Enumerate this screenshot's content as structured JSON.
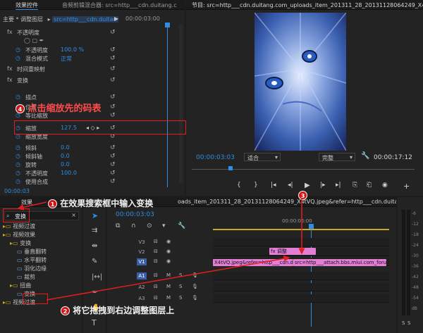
{
  "effect_controls": {
    "tab": "效果控件",
    "tab_audio": "音频剪辑混合器: src=http___cdn.duitang.c",
    "breadcrumb_master": "主要 * 调整图层",
    "breadcrumb_clip": "src=http___cdn.duitan",
    "timecode_top": "00:00:03:00",
    "rows": [
      {
        "label": "不透明度",
        "prefix": "fx"
      },
      {
        "label": "不透明度",
        "value": "100.0 %"
      },
      {
        "label": "混合模式",
        "value": "正常"
      },
      {
        "label": "时间重映射",
        "prefix": "fx"
      },
      {
        "label": "变换",
        "prefix": "fx"
      },
      {
        "label": "描点",
        "value": ""
      },
      {
        "label": "位置",
        "value": ""
      },
      {
        "label": "等比缩放",
        "value": ""
      },
      {
        "label": "缩放",
        "value": "127.5"
      },
      {
        "label": "缩放宽度",
        "value": ""
      },
      {
        "label": "倾斜",
        "value": "0.0"
      },
      {
        "label": "倾斜轴",
        "value": "0.0"
      },
      {
        "label": "旋转",
        "value": "0.0"
      },
      {
        "label": "不透明度",
        "value": "100.0"
      },
      {
        "label": "使用合成",
        "value": ""
      }
    ],
    "timecode_bottom": "00:00:03"
  },
  "program": {
    "title": "节目: src=http___cdn.duitang.com_uploads_item_201311_28_20131128064249_X4tVQ.jpeg&refer=h",
    "timecode": "00:00:03:03",
    "fit": "适合",
    "quality": "完整",
    "duration": "00:00:17:12"
  },
  "effects": {
    "tab": "效果",
    "search_value": "变换",
    "tree": [
      {
        "label": "视频过渡",
        "indent": 0
      },
      {
        "label": "视频效果",
        "indent": 0
      },
      {
        "label": "变换",
        "indent": 1
      },
      {
        "label": "垂直翻转",
        "indent": 2
      },
      {
        "label": "水平翻转",
        "indent": 2
      },
      {
        "label": "羽化边缘",
        "indent": 2
      },
      {
        "label": "裁剪",
        "indent": 2
      },
      {
        "label": "扭曲",
        "indent": 1
      },
      {
        "label": "变换",
        "indent": 2
      },
      {
        "label": "视频过渡",
        "indent": 0
      }
    ]
  },
  "timeline": {
    "tab": "oads_item_201311_28_20131128064249_X4tVQ.jpeg&refer=http___cdn.duitang",
    "timecode": "00:00:03:03",
    "ruler_time": "00:00:05:00",
    "tracks": [
      {
        "name": "V3"
      },
      {
        "name": "V2"
      },
      {
        "name": "V1"
      },
      {
        "name": "A1"
      },
      {
        "name": "A2"
      },
      {
        "name": "A3"
      }
    ],
    "clip_v2": "fx 调整",
    "clip_v1a": "X4tVQ.jpeg&refer=http___cdn.duitang",
    "clip_v1b": "src=http___attach.bbs.miui.com_forum_2019"
  },
  "annotations": {
    "a1": "在效果搜索框中输入变换",
    "a2": "将它拖拽到右边调整图层上",
    "a3": "",
    "a4": "点击缩放先的码表",
    "n1": "1",
    "n2": "2",
    "n3": "3",
    "n4": "4"
  },
  "meter": {
    "labels": [
      "-6",
      "-12",
      "-18",
      "-24",
      "-30",
      "-36",
      "-42",
      "-48",
      "-54",
      "dB"
    ]
  }
}
